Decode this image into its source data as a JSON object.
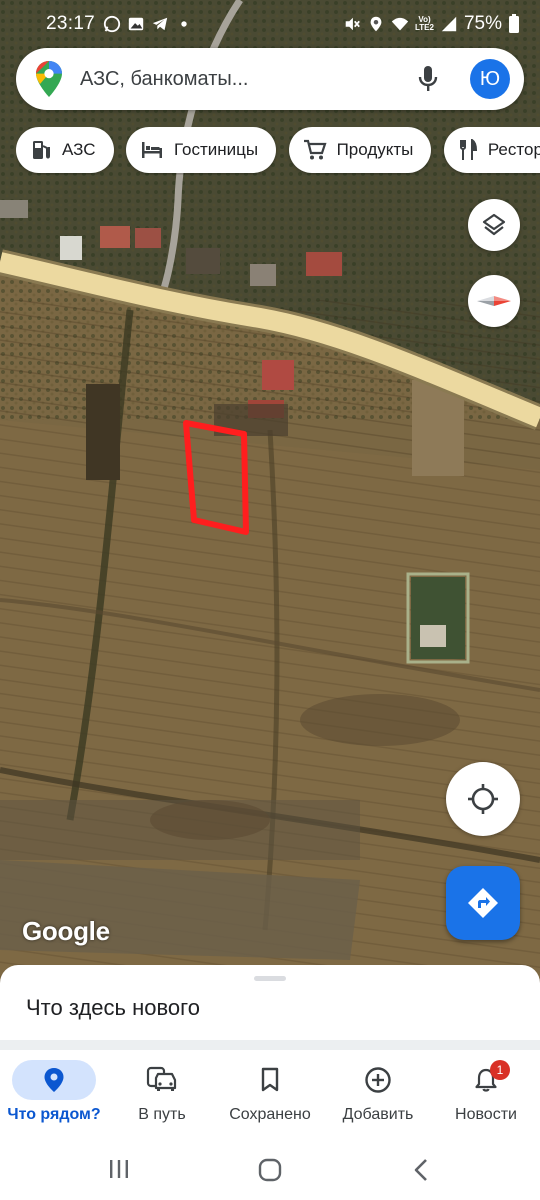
{
  "status_bar": {
    "time": "23:17",
    "battery": "75%",
    "network_label_top": "Vo)",
    "network_label_bottom": "LTE2"
  },
  "search": {
    "placeholder": "АЗС, банкоматы...",
    "avatar_letter": "Ю"
  },
  "chips": [
    {
      "label": "АЗС",
      "icon": "gas-station-icon"
    },
    {
      "label": "Гостиницы",
      "icon": "hotel-bed-icon"
    },
    {
      "label": "Продукты",
      "icon": "shopping-cart-icon"
    },
    {
      "label": "Ресторан",
      "icon": "restaurant-icon"
    }
  ],
  "map": {
    "watermark": "Google"
  },
  "bottom_sheet": {
    "title": "Что здесь нового"
  },
  "bottom_nav": [
    {
      "label": "Что рядом?",
      "icon": "location-pin-icon",
      "active": true
    },
    {
      "label": "В путь",
      "icon": "commute-car-icon",
      "active": false
    },
    {
      "label": "Сохранено",
      "icon": "bookmark-icon",
      "active": false
    },
    {
      "label": "Добавить",
      "icon": "add-circle-icon",
      "active": false
    },
    {
      "label": "Новости",
      "icon": "bell-icon",
      "active": false,
      "badge": "1"
    }
  ],
  "colors": {
    "accent": "#1a73e8",
    "active_pill": "#d3e3fd",
    "road": "#ecd9a0",
    "marked_plot": "#ff1e1e",
    "badge": "#d93025"
  }
}
